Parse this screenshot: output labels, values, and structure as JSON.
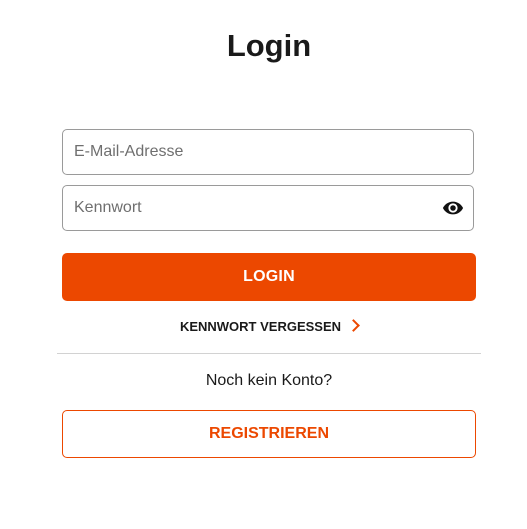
{
  "page": {
    "title": "Login"
  },
  "form": {
    "email": {
      "placeholder": "E-Mail-Adresse",
      "value": ""
    },
    "password": {
      "placeholder": "Kennwort",
      "value": "",
      "toggle_icon": "eye-icon"
    },
    "login_label": "LOGIN",
    "forgot_label": "KENNWORT VERGESSEN",
    "forgot_icon": "chevron-right-icon"
  },
  "register": {
    "prompt": "Noch kein Konto?",
    "button_label": "REGISTRIEREN"
  },
  "colors": {
    "accent": "#ec4800",
    "text": "#1a1a1a",
    "border": "#9a9a9a",
    "divider": "#d2d2d2"
  }
}
